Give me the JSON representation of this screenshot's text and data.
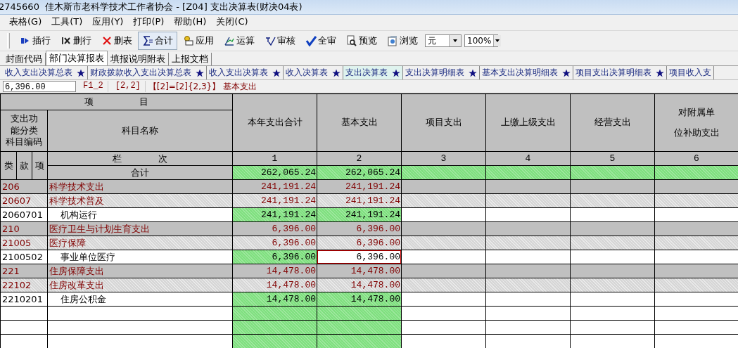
{
  "window": {
    "title": "2745660  佳木斯市老科学技术工作者协会 - [Z04] 支出决算表(财决04表)"
  },
  "menu": [
    "表格(G)",
    "工具(T)",
    "应用(Y)",
    "打印(P)",
    "帮助(H)",
    "关闭(C)"
  ],
  "toolbar": {
    "buttons": [
      {
        "label": "插行",
        "kind": "insert",
        "selected": false
      },
      {
        "label": "删行",
        "kind": "deleterow",
        "selected": false
      },
      {
        "label": "删表",
        "kind": "deletetable",
        "selected": false
      },
      {
        "label": "合计",
        "kind": "sum",
        "selected": true
      },
      {
        "label": "应用",
        "kind": "apply",
        "selected": false
      },
      {
        "label": "运算",
        "kind": "calc",
        "selected": false
      },
      {
        "label": "审核",
        "kind": "check",
        "selected": false
      },
      {
        "label": "全审",
        "kind": "checkall",
        "selected": false
      },
      {
        "label": "预览",
        "kind": "preview",
        "selected": false
      },
      {
        "label": "浏览",
        "kind": "browse",
        "selected": false
      }
    ],
    "unit": "元",
    "zoom": "100%"
  },
  "report_tabs": [
    {
      "label": "封面代码",
      "selected": false
    },
    {
      "label": "部门决算报表",
      "selected": true
    },
    {
      "label": "填报说明附表",
      "selected": false
    },
    {
      "label": "上报文档",
      "selected": false
    }
  ],
  "sheet_tabs": [
    {
      "label": "收入支出决算总表",
      "starred": true,
      "selected": false
    },
    {
      "label": "财政拨款收入支出决算总表",
      "starred": true,
      "selected": false
    },
    {
      "label": "收入支出决算表",
      "starred": true,
      "selected": false
    },
    {
      "label": "收入决算表",
      "starred": true,
      "selected": false
    },
    {
      "label": "支出决算表",
      "starred": true,
      "selected": true
    },
    {
      "label": "支出决算明细表",
      "starred": true,
      "selected": false
    },
    {
      "label": "基本支出决算明细表",
      "starred": true,
      "selected": false
    },
    {
      "label": "项目支出决算明细表",
      "starred": true,
      "selected": false
    },
    {
      "label": "项目收入支",
      "starred": false,
      "selected": false
    }
  ],
  "formula_bar": {
    "value": "6,396.00",
    "cell_name": "F1_2",
    "cell_ref": "[2,2]",
    "formula": "【[2]=[2]{2,3}】 基本支出"
  },
  "table": {
    "header_title": "项　　　　　目",
    "code_header": "支出功能分类科目编码",
    "name_header": "科目名称",
    "column_index_label": "栏　　　　次",
    "code_parts": [
      "类",
      "款",
      "项"
    ],
    "columns": [
      {
        "label": "本年支出合计",
        "number": "1"
      },
      {
        "label": "基本支出",
        "number": "2"
      },
      {
        "label": "项目支出",
        "number": "3"
      },
      {
        "label": "上缴上级支出",
        "number": "4"
      },
      {
        "label": "经营支出",
        "number": "5"
      },
      {
        "label": "对附属单位补助支出",
        "number": "6"
      }
    ],
    "rows": [
      {
        "kind": "total",
        "name": "合计",
        "cells": [
          {
            "text": "262,065.24",
            "selected": false
          },
          {
            "text": "262,065.24",
            "selected": false
          }
        ]
      },
      {
        "kind": "category",
        "code": "206",
        "name": "科学技术支出",
        "cells": [
          {
            "text": "241,191.24",
            "selected": false
          },
          {
            "text": "241,191.24",
            "selected": false
          }
        ]
      },
      {
        "kind": "section",
        "code": "20607",
        "name": "科学技术普及",
        "cells": [
          {
            "text": "241,191.24",
            "selected": false
          },
          {
            "text": "241,191.24",
            "selected": false
          }
        ]
      },
      {
        "kind": "item",
        "code": "2060701",
        "name": "机构运行",
        "cells": [
          {
            "text": "241,191.24",
            "selected": false
          },
          {
            "text": "241,191.24",
            "selected": false
          }
        ]
      },
      {
        "kind": "category",
        "code": "210",
        "name": "医疗卫生与计划生育支出",
        "cells": [
          {
            "text": "6,396.00",
            "selected": false
          },
          {
            "text": "6,396.00",
            "selected": false
          }
        ]
      },
      {
        "kind": "section",
        "code": "21005",
        "name": "医疗保障",
        "cells": [
          {
            "text": "6,396.00",
            "selected": false
          },
          {
            "text": "6,396.00",
            "selected": false
          }
        ]
      },
      {
        "kind": "item",
        "code": "2100502",
        "name": "事业单位医疗",
        "cells": [
          {
            "text": "6,396.00",
            "selected": false
          },
          {
            "text": "6,396.00",
            "selected": true
          }
        ]
      },
      {
        "kind": "category",
        "code": "221",
        "name": "住房保障支出",
        "cells": [
          {
            "text": "14,478.00",
            "selected": false
          },
          {
            "text": "14,478.00",
            "selected": false
          }
        ]
      },
      {
        "kind": "section",
        "code": "22102",
        "name": "住房改革支出",
        "cells": [
          {
            "text": "14,478.00",
            "selected": false
          },
          {
            "text": "14,478.00",
            "selected": false
          }
        ]
      },
      {
        "kind": "item",
        "code": "2210201",
        "name": "住房公积金",
        "cells": [
          {
            "text": "14,478.00",
            "selected": false
          },
          {
            "text": "14,478.00",
            "selected": false
          }
        ]
      },
      {
        "kind": "blank"
      },
      {
        "kind": "blank"
      },
      {
        "kind": "blank"
      }
    ]
  }
}
